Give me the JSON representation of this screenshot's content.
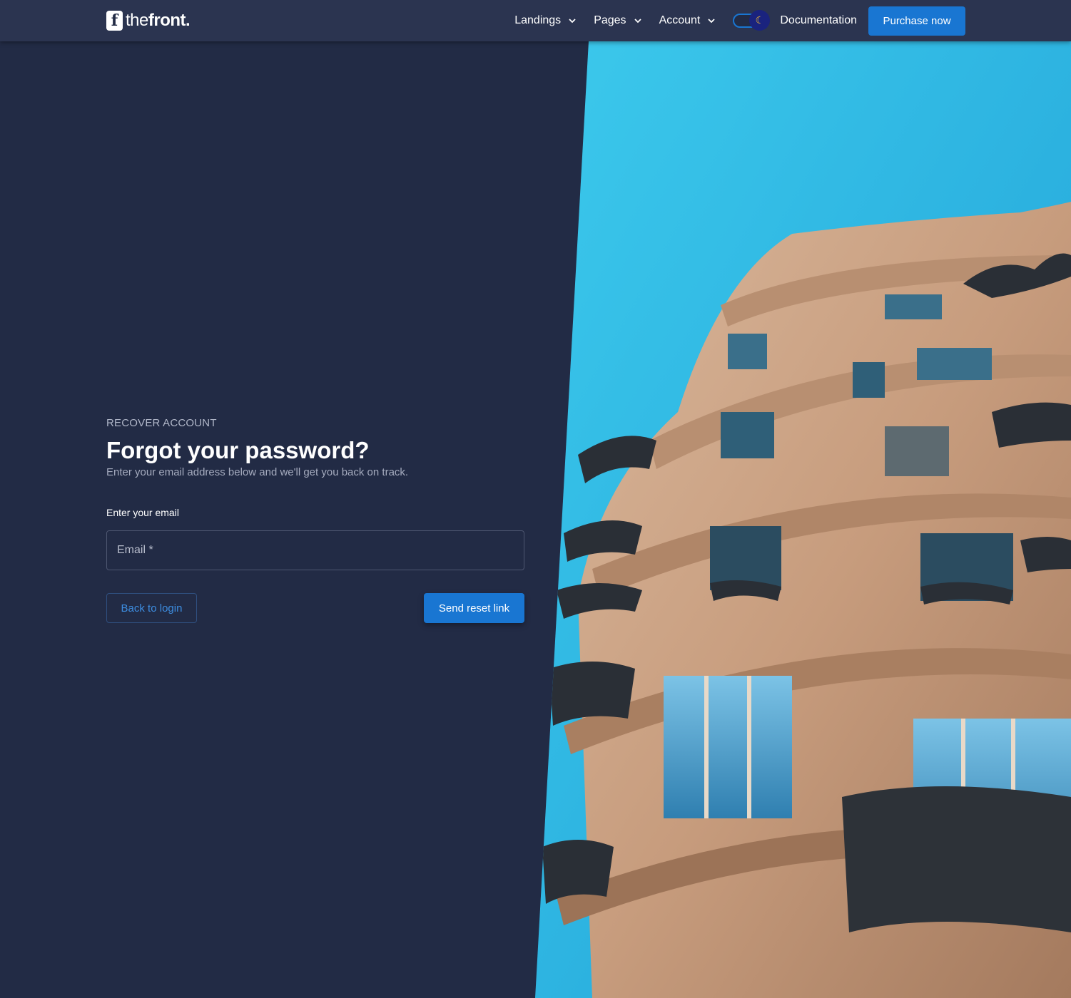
{
  "header": {
    "logo": {
      "icon": "f-logo-icon",
      "text_light": "the",
      "text_bold": "front."
    },
    "nav": [
      {
        "label": "Landings",
        "icon": "chevron-down-icon"
      },
      {
        "label": "Pages",
        "icon": "chevron-down-icon"
      },
      {
        "label": "Account",
        "icon": "chevron-down-icon"
      }
    ],
    "theme_toggle": {
      "icon": "moon-icon",
      "state": "dark"
    },
    "documentation_label": "Documentation",
    "purchase_label": "Purchase now"
  },
  "form": {
    "overline": "RECOVER ACCOUNT",
    "title": "Forgot your password?",
    "subtitle": "Enter your email address below and we'll get you back on track.",
    "email_label": "Enter your email",
    "email_placeholder": "Email *",
    "email_value": "",
    "back_label": "Back to login",
    "send_label": "Send reset link"
  },
  "colors": {
    "background": "#222b45",
    "header": "#2b3450",
    "primary": "#1976d2",
    "sky": "#2ab4e0"
  }
}
